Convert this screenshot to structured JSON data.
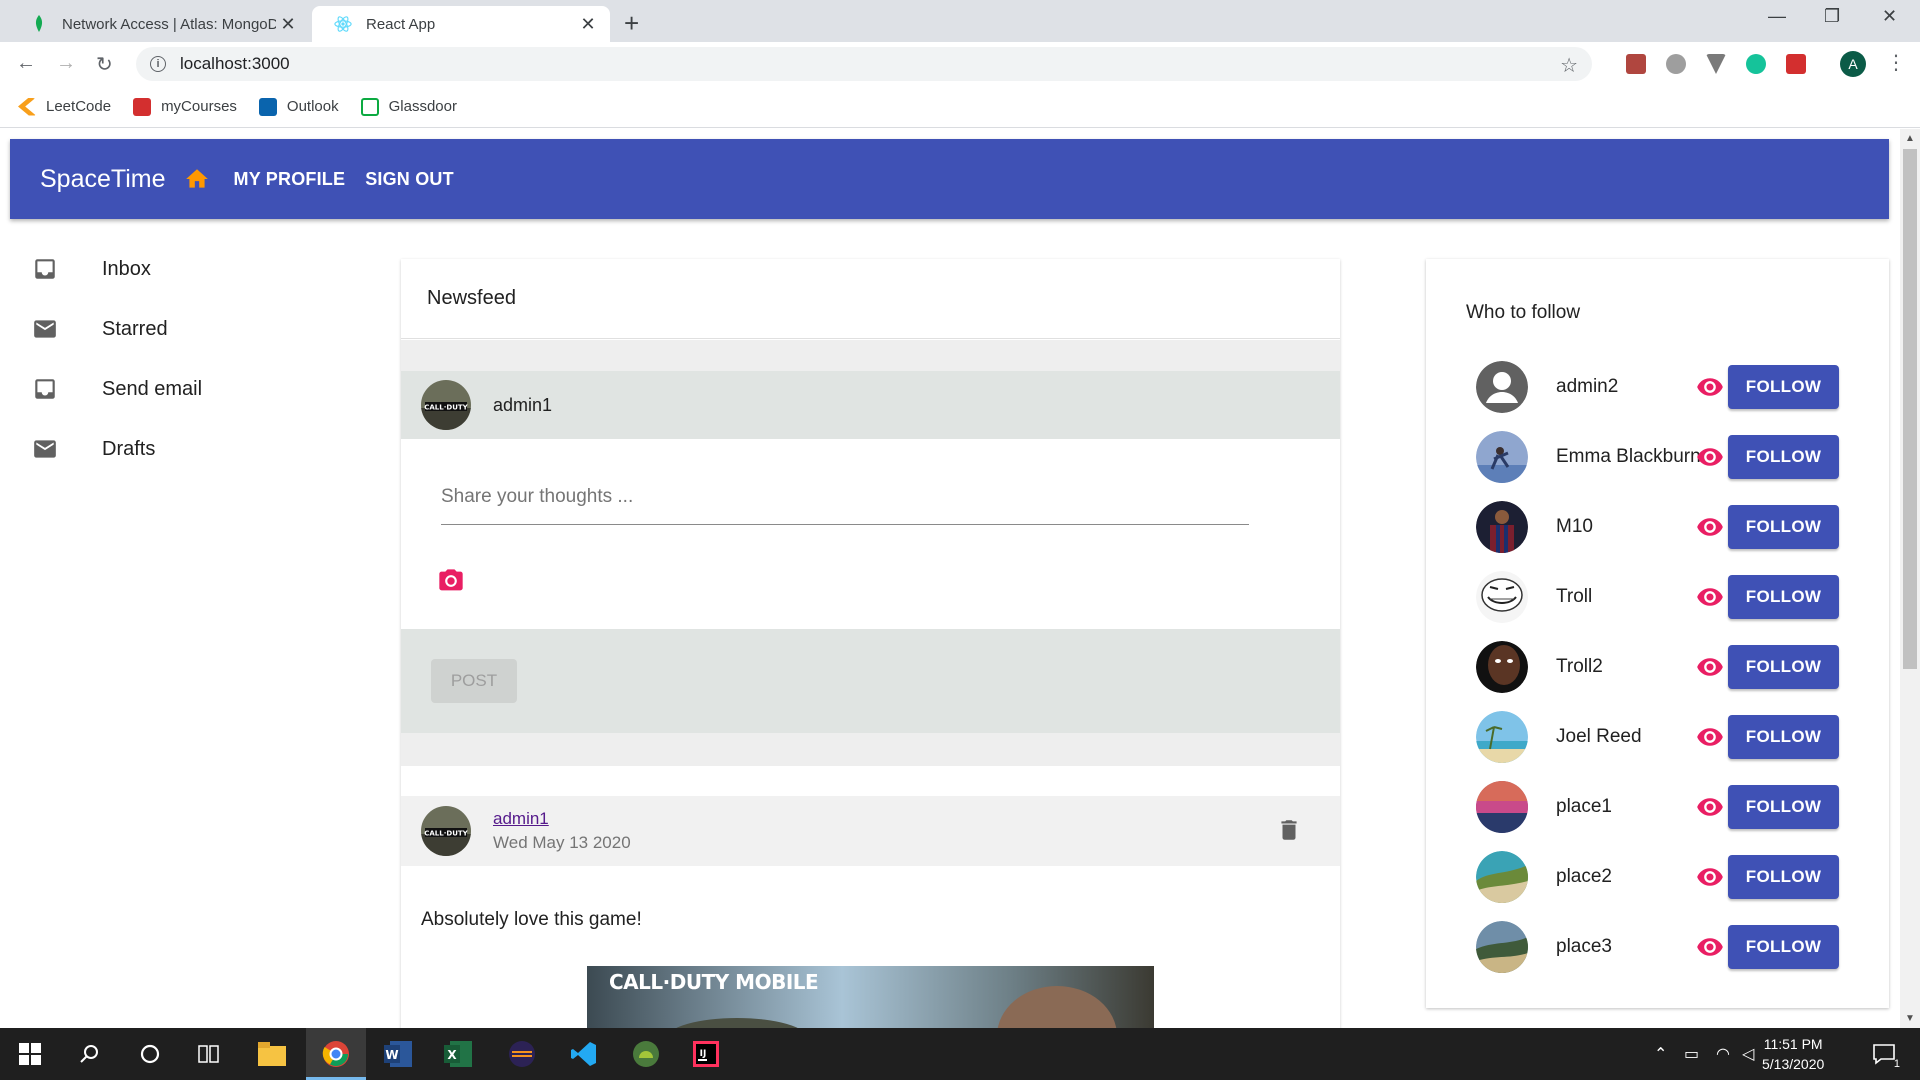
{
  "browser": {
    "tabs": [
      {
        "title": "Network Access | Atlas: MongoDB",
        "active": false
      },
      {
        "title": "React App",
        "active": true
      }
    ],
    "url": "localhost:3000",
    "bookmarks": [
      {
        "label": "LeetCode",
        "icon": "leetcode-icon"
      },
      {
        "label": "myCourses",
        "icon": "mycourses-icon"
      },
      {
        "label": "Outlook",
        "icon": "outlook-icon"
      },
      {
        "label": "Glassdoor",
        "icon": "glassdoor-icon"
      }
    ],
    "account_initial": "A"
  },
  "app": {
    "brand": "SpaceTime",
    "nav": {
      "my_profile": "MY PROFILE",
      "sign_out": "SIGN OUT"
    },
    "colors": {
      "primary": "#3f51b5",
      "accent": "#e91e63",
      "home_icon": "#ff9800"
    }
  },
  "sidebar": {
    "items": [
      {
        "label": "Inbox",
        "icon": "inbox-icon"
      },
      {
        "label": "Starred",
        "icon": "mail-icon"
      },
      {
        "label": "Send email",
        "icon": "inbox-icon"
      },
      {
        "label": "Drafts",
        "icon": "mail-icon"
      }
    ]
  },
  "newsfeed": {
    "title": "Newsfeed",
    "composer": {
      "user": "admin1",
      "placeholder": "Share your thoughts ...",
      "post_label": "POST"
    },
    "post": {
      "user": "admin1",
      "date": "Wed May 13 2020",
      "text": "Absolutely love this game!",
      "image_caption": "CALL·DUTY MOBILE"
    }
  },
  "who_to_follow": {
    "title": "Who to follow",
    "button_label": "FOLLOW",
    "users": [
      {
        "name": "admin2"
      },
      {
        "name": "Emma Blackburn"
      },
      {
        "name": "M10"
      },
      {
        "name": "Troll"
      },
      {
        "name": "Troll2"
      },
      {
        "name": "Joel Reed"
      },
      {
        "name": "place1"
      },
      {
        "name": "place2"
      },
      {
        "name": "place3"
      }
    ]
  },
  "taskbar": {
    "time": "11:51 PM",
    "date": "5/13/2020",
    "notification_count": "1"
  }
}
